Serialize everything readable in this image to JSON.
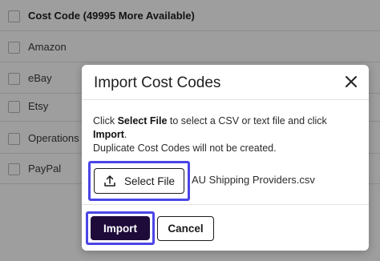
{
  "background_list": {
    "header": "Cost Code (49995 More Available)",
    "rows": [
      "Amazon",
      "eBay",
      "Etsy",
      "Operations",
      "PayPal"
    ]
  },
  "modal": {
    "title": "Import Cost Codes",
    "close_icon": "close-icon",
    "description": {
      "part1": "Click ",
      "bold1": "Select File",
      "part2": " to select a CSV or text file and click ",
      "bold2": "Import",
      "part3": ".",
      "line2": "Duplicate Cost Codes will not be created."
    },
    "select_file_label": "Select File",
    "upload_icon": "upload-icon",
    "selected_filename": "AU Shipping Providers.csv",
    "import_label": "Import",
    "cancel_label": "Cancel"
  },
  "colors": {
    "highlight": "#4a45e6",
    "primary_button": "#1e0b3a"
  }
}
